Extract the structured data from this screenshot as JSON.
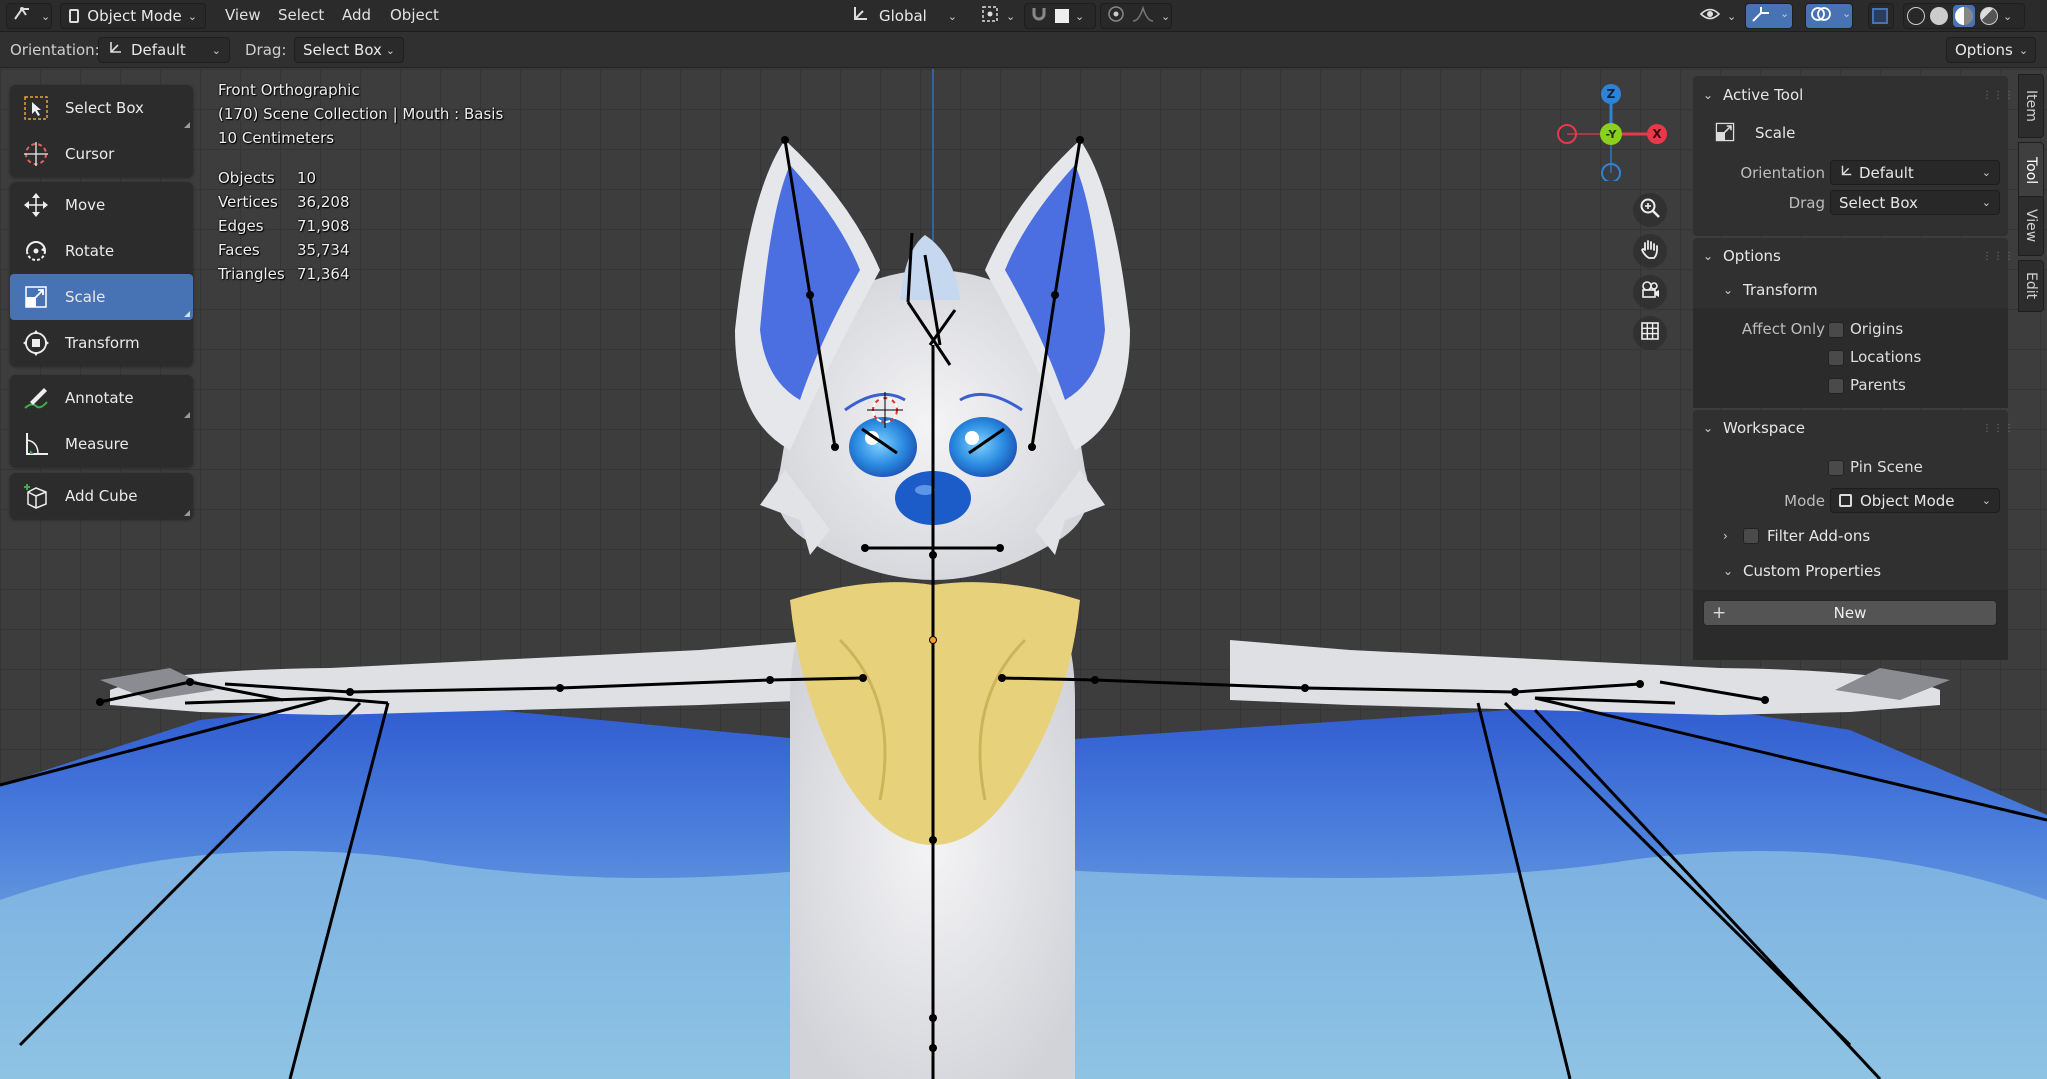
{
  "header": {
    "mode": "Object Mode",
    "menus": [
      "View",
      "Select",
      "Add",
      "Object"
    ],
    "transform_orientation": "Global"
  },
  "tool_header": {
    "orientation_label": "Orientation:",
    "orientation_value": "Default",
    "drag_label": "Drag:",
    "drag_value": "Select Box",
    "options": "Options"
  },
  "toolbar": {
    "tools": [
      {
        "label": "Select Box",
        "icon": "select-box-icon"
      },
      {
        "label": "Cursor",
        "icon": "cursor-icon"
      },
      {
        "label": "Move",
        "icon": "move-icon"
      },
      {
        "label": "Rotate",
        "icon": "rotate-icon"
      },
      {
        "label": "Scale",
        "icon": "scale-icon",
        "active": true
      },
      {
        "label": "Transform",
        "icon": "transform-icon"
      },
      {
        "label": "Annotate",
        "icon": "annotate-icon"
      },
      {
        "label": "Measure",
        "icon": "measure-icon"
      },
      {
        "label": "Add Cube",
        "icon": "add-cube-icon"
      }
    ]
  },
  "overlay": {
    "view_name": "Front Orthographic",
    "collection": "(170) Scene Collection | Mouth : Basis",
    "grid_scale": "10 Centimeters",
    "stats": [
      {
        "label": "Objects",
        "value": "10"
      },
      {
        "label": "Vertices",
        "value": "36,208"
      },
      {
        "label": "Edges",
        "value": "71,908"
      },
      {
        "label": "Faces",
        "value": "35,734"
      },
      {
        "label": "Triangles",
        "value": "71,364"
      }
    ]
  },
  "gizmo": {
    "z": "Z",
    "y": "-Y",
    "x": "X"
  },
  "npanel": {
    "active_tool": {
      "title": "Active Tool",
      "tool_name": "Scale",
      "orientation_label": "Orientation",
      "orientation_value": "Default",
      "drag_label": "Drag",
      "drag_value": "Select Box"
    },
    "options": {
      "title": "Options",
      "transform_title": "Transform",
      "affect_only_label": "Affect Only",
      "checks": [
        "Origins",
        "Locations",
        "Parents"
      ]
    },
    "workspace": {
      "title": "Workspace",
      "pin_scene": "Pin Scene",
      "mode_label": "Mode",
      "mode_value": "Object Mode",
      "filter_addons": "Filter Add-ons",
      "custom_properties": "Custom Properties",
      "new_button": "New"
    }
  },
  "side_tabs": [
    "Item",
    "Tool",
    "View",
    "Edit"
  ],
  "colors": {
    "accent": "#4772b3",
    "x_axis": "#e8394b",
    "y_axis": "#8bd11b",
    "z_axis": "#2f83d6"
  }
}
